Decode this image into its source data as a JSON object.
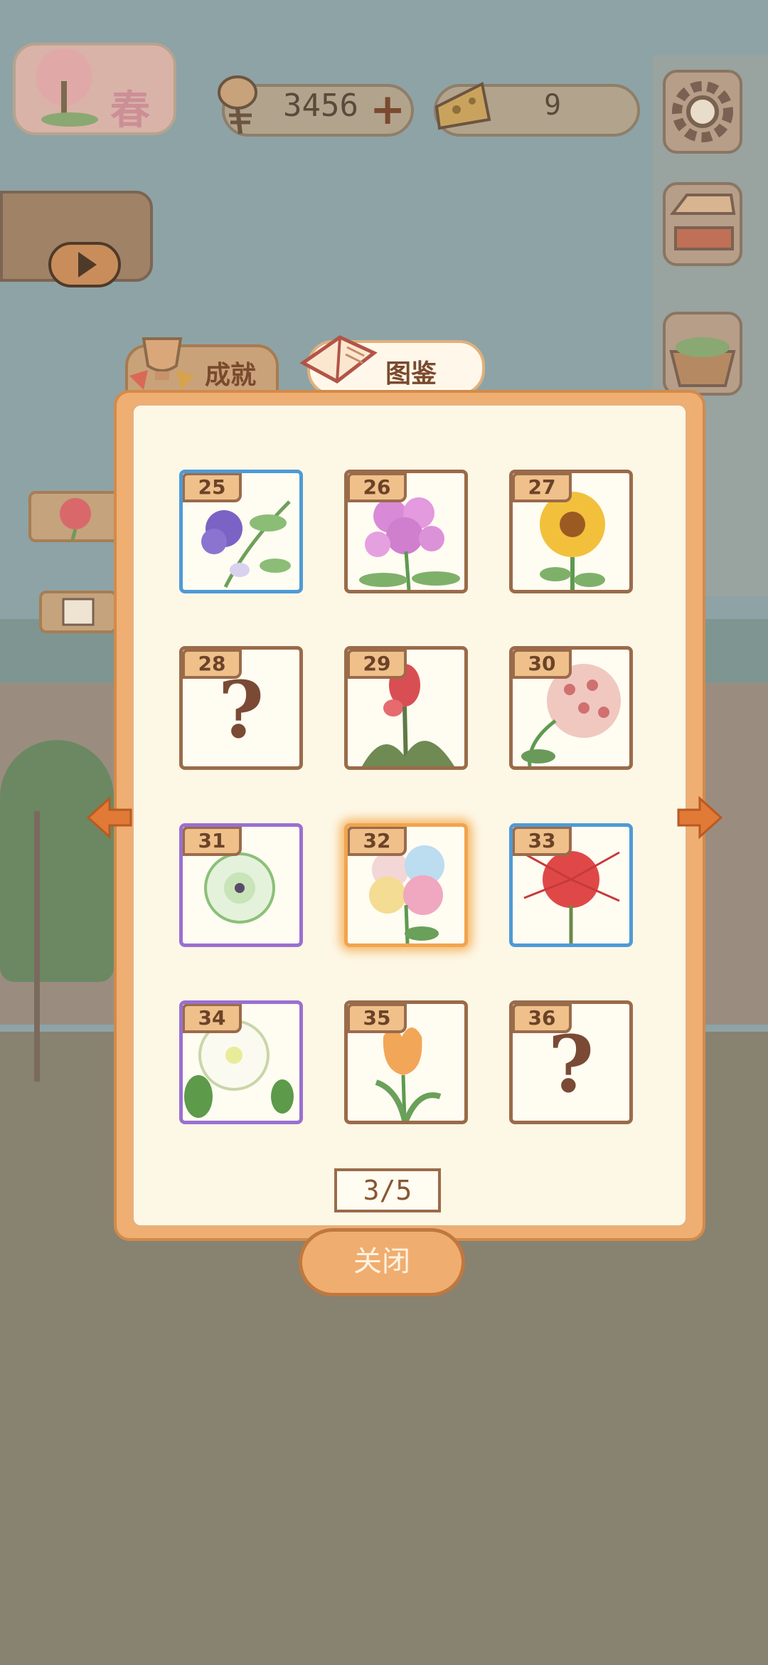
{
  "top_bar": {
    "season_label": "春",
    "fish_bones": "3456",
    "cheese": "9"
  },
  "tabs": {
    "achievements_label": "成就",
    "collection_label": "图鉴"
  },
  "cards": [
    {
      "number": "25",
      "state": "discovered",
      "frame": "blue"
    },
    {
      "number": "26",
      "state": "discovered",
      "frame": "brown"
    },
    {
      "number": "27",
      "state": "discovered",
      "frame": "brown"
    },
    {
      "number": "28",
      "state": "unknown",
      "frame": "brown",
      "mark": "?"
    },
    {
      "number": "29",
      "state": "discovered",
      "frame": "brown"
    },
    {
      "number": "30",
      "state": "discovered",
      "frame": "brown"
    },
    {
      "number": "31",
      "state": "discovered",
      "frame": "purple"
    },
    {
      "number": "32",
      "state": "discovered",
      "frame": "gold-glow"
    },
    {
      "number": "33",
      "state": "discovered",
      "frame": "blue"
    },
    {
      "number": "34",
      "state": "discovered",
      "frame": "purple"
    },
    {
      "number": "35",
      "state": "discovered",
      "frame": "brown"
    },
    {
      "number": "36",
      "state": "unknown",
      "frame": "brown",
      "mark": "?"
    }
  ],
  "pagination": {
    "label": "3/5"
  },
  "close_label": "关闭",
  "colors": {
    "panel": "#efae72",
    "panel_inner": "#fdf7e6",
    "frame_brown": "#9a6b4a",
    "frame_blue": "#4e9ad6",
    "frame_purple": "#9a6fd0",
    "arrow": "#e07a36"
  }
}
